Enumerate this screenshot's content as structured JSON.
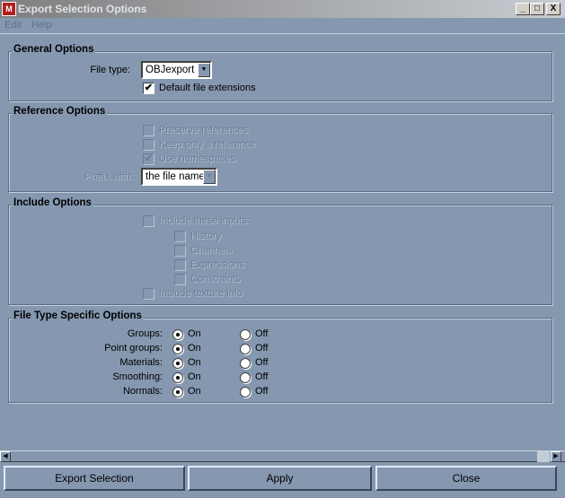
{
  "window": {
    "title": "Export Selection Options",
    "icon": "maya-app-icon",
    "controls": {
      "minimize": "_",
      "maximize": "□",
      "close": "X"
    }
  },
  "menubar": {
    "items": [
      "Edit",
      "Help"
    ]
  },
  "colors": {
    "background": "#8598b0",
    "disabled_text": "#6a7d96"
  },
  "general": {
    "title": "General Options",
    "file_type_label": "File type:",
    "file_type_value": "OBJexport",
    "default_ext_label": "Default file extensions",
    "default_ext_checked": true
  },
  "reference": {
    "title": "Reference Options",
    "preserve_label": "Preserve references",
    "preserve_checked": false,
    "keep_label": "Keep only a reference",
    "keep_checked": false,
    "namespaces_label": "Use namespaces",
    "namespaces_checked": true,
    "prefix_label": "Prefix with:",
    "prefix_value": "the file name",
    "disabled": true
  },
  "include": {
    "title": "Include Options",
    "inputs_label": "Include these inputs:",
    "history": "History",
    "channels": "Channels",
    "expressions": "Expressions",
    "constraints": "Constraints",
    "texture_label": "Include texture info",
    "disabled": true
  },
  "filetype": {
    "title": "File Type Specific Options",
    "on_label": "On",
    "off_label": "Off",
    "rows": [
      {
        "label": "Groups:",
        "value": "On"
      },
      {
        "label": "Point groups:",
        "value": "On"
      },
      {
        "label": "Materials:",
        "value": "On"
      },
      {
        "label": "Smoothing:",
        "value": "On"
      },
      {
        "label": "Normals:",
        "value": "On"
      }
    ]
  },
  "buttons": {
    "export": "Export Selection",
    "apply": "Apply",
    "close": "Close"
  }
}
